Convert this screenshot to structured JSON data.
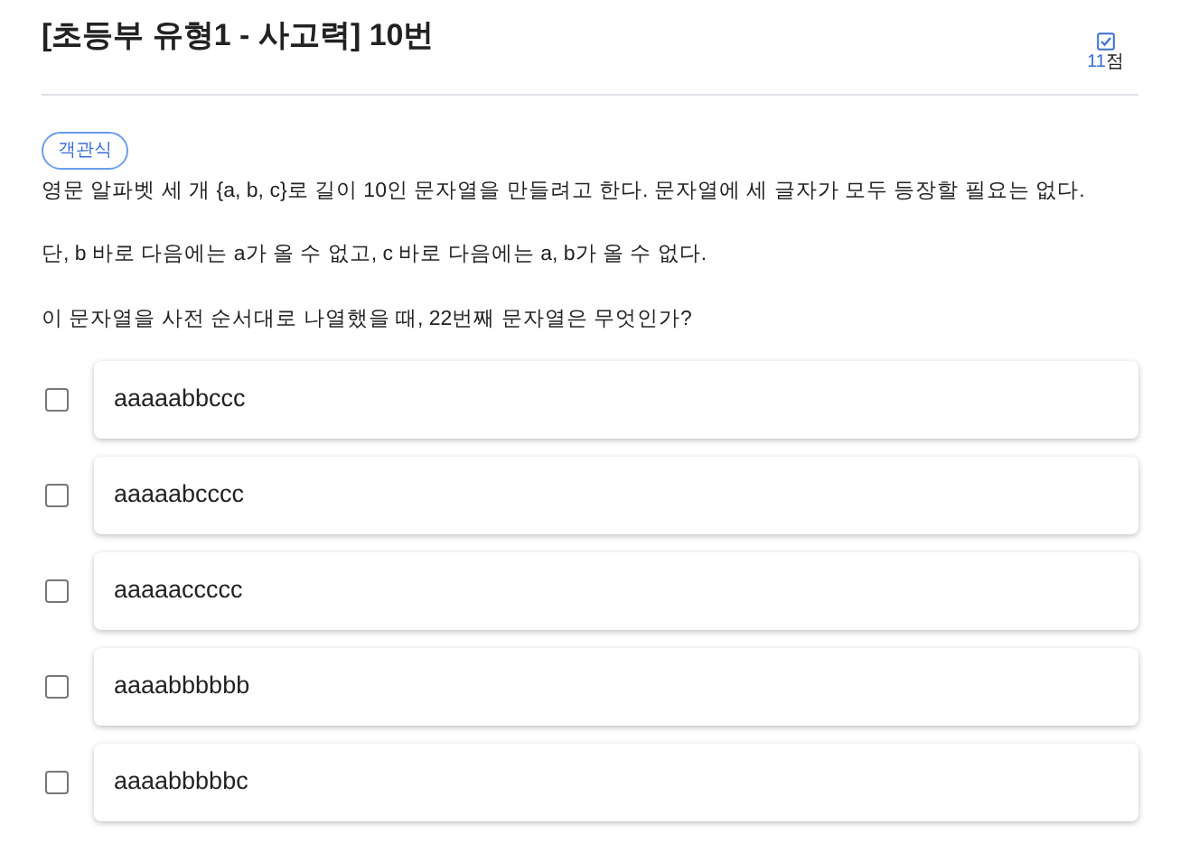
{
  "title": "[초등부 유형1 - 사고력] 10번",
  "score": {
    "value": "11",
    "unit": "점"
  },
  "question_type": "객관식",
  "paragraphs": [
    "영문 알파벳 세 개 {a, b, c}로 길이 10인 문자열을 만들려고 한다. 문자열에 세 글자가 모두 등장할 필요는 없다.",
    "단, b 바로 다음에는 a가 올 수 없고, c 바로 다음에는 a, b가 올 수 없다.",
    "이 문자열을 사전 순서대로 나열했을 때, 22번째 문자열은 무엇인가?"
  ],
  "options": [
    {
      "label": "aaaaabbccc",
      "checked": false
    },
    {
      "label": "aaaaabcccc",
      "checked": false
    },
    {
      "label": "aaaaaccccc",
      "checked": false
    },
    {
      "label": "aaaabbbbbb",
      "checked": false
    },
    {
      "label": "aaaabbbbbc",
      "checked": false
    }
  ]
}
